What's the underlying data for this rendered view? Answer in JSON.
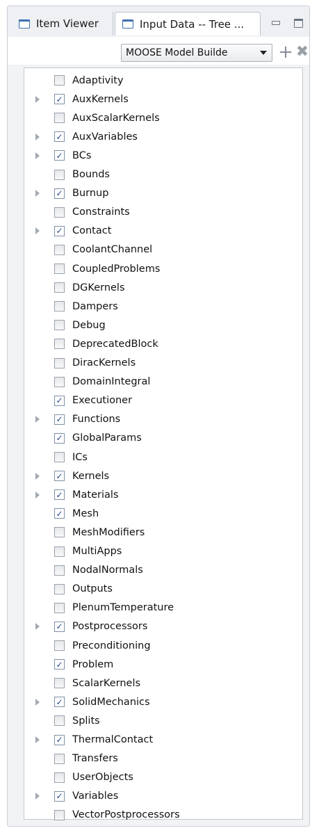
{
  "tabs": [
    {
      "label": "Item Viewer",
      "active": false
    },
    {
      "label": "Input Data -- Tree ...",
      "active": true
    }
  ],
  "toolbar": {
    "model_select_value": "MOOSE Model Builde",
    "add_label": "+",
    "remove_label": "✖"
  },
  "tree": {
    "items": [
      {
        "label": "Adaptivity",
        "checked": false,
        "expandable": false
      },
      {
        "label": "AuxKernels",
        "checked": true,
        "expandable": true
      },
      {
        "label": "AuxScalarKernels",
        "checked": false,
        "expandable": false
      },
      {
        "label": "AuxVariables",
        "checked": true,
        "expandable": true
      },
      {
        "label": "BCs",
        "checked": true,
        "expandable": true
      },
      {
        "label": "Bounds",
        "checked": false,
        "expandable": false
      },
      {
        "label": "Burnup",
        "checked": true,
        "expandable": true
      },
      {
        "label": "Constraints",
        "checked": false,
        "expandable": false
      },
      {
        "label": "Contact",
        "checked": true,
        "expandable": true
      },
      {
        "label": "CoolantChannel",
        "checked": false,
        "expandable": false
      },
      {
        "label": "CoupledProblems",
        "checked": false,
        "expandable": false
      },
      {
        "label": "DGKernels",
        "checked": false,
        "expandable": false
      },
      {
        "label": "Dampers",
        "checked": false,
        "expandable": false
      },
      {
        "label": "Debug",
        "checked": false,
        "expandable": false
      },
      {
        "label": "DeprecatedBlock",
        "checked": false,
        "expandable": false
      },
      {
        "label": "DiracKernels",
        "checked": false,
        "expandable": false
      },
      {
        "label": "DomainIntegral",
        "checked": false,
        "expandable": false
      },
      {
        "label": "Executioner",
        "checked": true,
        "expandable": false
      },
      {
        "label": "Functions",
        "checked": true,
        "expandable": true
      },
      {
        "label": "GlobalParams",
        "checked": true,
        "expandable": false
      },
      {
        "label": "ICs",
        "checked": false,
        "expandable": false
      },
      {
        "label": "Kernels",
        "checked": true,
        "expandable": true
      },
      {
        "label": "Materials",
        "checked": true,
        "expandable": true
      },
      {
        "label": "Mesh",
        "checked": true,
        "expandable": false
      },
      {
        "label": "MeshModifiers",
        "checked": false,
        "expandable": false
      },
      {
        "label": "MultiApps",
        "checked": false,
        "expandable": false
      },
      {
        "label": "NodalNormals",
        "checked": false,
        "expandable": false
      },
      {
        "label": "Outputs",
        "checked": false,
        "expandable": false
      },
      {
        "label": "PlenumTemperature",
        "checked": false,
        "expandable": false
      },
      {
        "label": "Postprocessors",
        "checked": true,
        "expandable": true
      },
      {
        "label": "Preconditioning",
        "checked": false,
        "expandable": false
      },
      {
        "label": "Problem",
        "checked": true,
        "expandable": false
      },
      {
        "label": "ScalarKernels",
        "checked": false,
        "expandable": false
      },
      {
        "label": "SolidMechanics",
        "checked": true,
        "expandable": true
      },
      {
        "label": "Splits",
        "checked": false,
        "expandable": false
      },
      {
        "label": "ThermalContact",
        "checked": true,
        "expandable": true
      },
      {
        "label": "Transfers",
        "checked": false,
        "expandable": false
      },
      {
        "label": "UserObjects",
        "checked": false,
        "expandable": false
      },
      {
        "label": "Variables",
        "checked": true,
        "expandable": true
      },
      {
        "label": "VectorPostprocessors",
        "checked": false,
        "expandable": false
      }
    ]
  }
}
